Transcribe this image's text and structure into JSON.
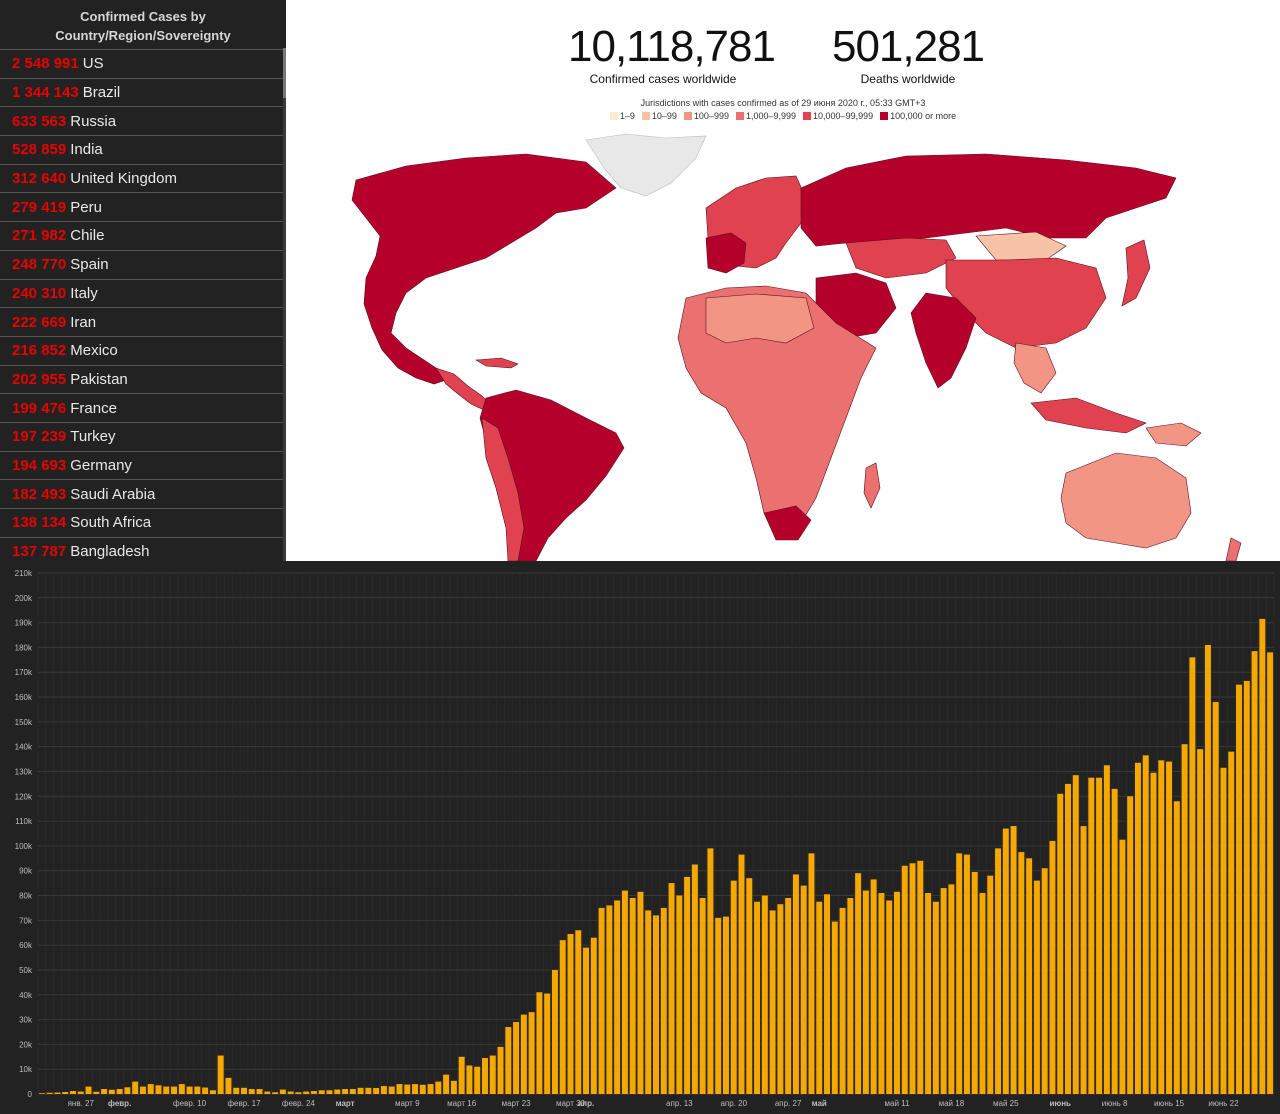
{
  "panel": {
    "title_line1": "Confirmed Cases by",
    "title_line2": "Country/Region/Sovereignty",
    "countries": [
      {
        "cases": "2 548 991",
        "name": "US"
      },
      {
        "cases": "1 344 143",
        "name": "Brazil"
      },
      {
        "cases": "633 563",
        "name": "Russia"
      },
      {
        "cases": "528 859",
        "name": "India"
      },
      {
        "cases": "312 640",
        "name": "United Kingdom"
      },
      {
        "cases": "279 419",
        "name": "Peru"
      },
      {
        "cases": "271 982",
        "name": "Chile"
      },
      {
        "cases": "248 770",
        "name": "Spain"
      },
      {
        "cases": "240 310",
        "name": "Italy"
      },
      {
        "cases": "222 669",
        "name": "Iran"
      },
      {
        "cases": "216 852",
        "name": "Mexico"
      },
      {
        "cases": "202 955",
        "name": "Pakistan"
      },
      {
        "cases": "199 476",
        "name": "France"
      },
      {
        "cases": "197 239",
        "name": "Turkey"
      },
      {
        "cases": "194 693",
        "name": "Germany"
      },
      {
        "cases": "182 493",
        "name": "Saudi Arabia"
      },
      {
        "cases": "138 134",
        "name": "South Africa"
      },
      {
        "cases": "137 787",
        "name": "Bangladesh"
      }
    ]
  },
  "map": {
    "confirmed_value": "10,118,781",
    "confirmed_label": "Confirmed cases worldwide",
    "deaths_value": "501,281",
    "deaths_label": "Deaths worldwide",
    "legend_title": "Jurisdictions with cases confirmed as of 29 июня 2020 г., 05:33 GMT+3",
    "legend": [
      {
        "label": "1–9",
        "color": "#fbeecb"
      },
      {
        "label": "10–99",
        "color": "#f7c3a6"
      },
      {
        "label": "100–999",
        "color": "#f29585"
      },
      {
        "label": "1,000–9,999",
        "color": "#eb7070"
      },
      {
        "label": "10,000–99,999",
        "color": "#e0434f"
      },
      {
        "label": "100,000 or more",
        "color": "#b5002b"
      }
    ]
  },
  "chart_data": {
    "type": "bar",
    "bar_color": "#f5a800",
    "background": "#222222",
    "grid": true,
    "ylim": [
      0,
      210000
    ],
    "yticks": [
      {
        "value": 0,
        "label": "0"
      },
      {
        "value": 10000,
        "label": "10k"
      },
      {
        "value": 20000,
        "label": "20k"
      },
      {
        "value": 30000,
        "label": "30k"
      },
      {
        "value": 40000,
        "label": "40k"
      },
      {
        "value": 50000,
        "label": "50k"
      },
      {
        "value": 60000,
        "label": "60k"
      },
      {
        "value": 70000,
        "label": "70k"
      },
      {
        "value": 80000,
        "label": "80k"
      },
      {
        "value": 90000,
        "label": "90k"
      },
      {
        "value": 100000,
        "label": "100k"
      },
      {
        "value": 110000,
        "label": "110k"
      },
      {
        "value": 120000,
        "label": "120k"
      },
      {
        "value": 130000,
        "label": "130k"
      },
      {
        "value": 140000,
        "label": "140k"
      },
      {
        "value": 150000,
        "label": "150k"
      },
      {
        "value": 160000,
        "label": "160k"
      },
      {
        "value": 170000,
        "label": "170k"
      },
      {
        "value": 180000,
        "label": "180k"
      },
      {
        "value": 190000,
        "label": "190k"
      },
      {
        "value": 200000,
        "label": "200k"
      },
      {
        "value": 210000,
        "label": "210k"
      }
    ],
    "xticks": [
      {
        "index": 5,
        "label": "янв. 27",
        "bold": false
      },
      {
        "index": 10,
        "label": "февр.",
        "bold": true
      },
      {
        "index": 19,
        "label": "февр. 10",
        "bold": false
      },
      {
        "index": 26,
        "label": "февр. 17",
        "bold": false
      },
      {
        "index": 33,
        "label": "февр. 24",
        "bold": false
      },
      {
        "index": 39,
        "label": "март",
        "bold": true
      },
      {
        "index": 47,
        "label": "март 9",
        "bold": false
      },
      {
        "index": 54,
        "label": "март 16",
        "bold": false
      },
      {
        "index": 61,
        "label": "март 23",
        "bold": false
      },
      {
        "index": 68,
        "label": "март 30",
        "bold": false
      },
      {
        "index": 70,
        "label": "апр.",
        "bold": true
      },
      {
        "index": 82,
        "label": "апр. 13",
        "bold": false
      },
      {
        "index": 89,
        "label": "апр. 20",
        "bold": false
      },
      {
        "index": 96,
        "label": "апр. 27",
        "bold": false
      },
      {
        "index": 100,
        "label": "май",
        "bold": true
      },
      {
        "index": 110,
        "label": "май 11",
        "bold": false
      },
      {
        "index": 117,
        "label": "май 18",
        "bold": false
      },
      {
        "index": 124,
        "label": "май 25",
        "bold": false
      },
      {
        "index": 131,
        "label": "июнь",
        "bold": true
      },
      {
        "index": 138,
        "label": "июнь 8",
        "bold": false
      },
      {
        "index": 145,
        "label": "июнь 15",
        "bold": false
      },
      {
        "index": 152,
        "label": "июнь 22",
        "bold": false
      }
    ],
    "values": [
      300,
      500,
      600,
      800,
      1200,
      1000,
      3000,
      900,
      2000,
      1700,
      2000,
      2700,
      5000,
      3000,
      4000,
      3500,
      3000,
      3000,
      4000,
      3000,
      3000,
      2600,
      1500,
      15500,
      6500,
      2500,
      2500,
      2000,
      2000,
      1000,
      700,
      1800,
      1000,
      700,
      1000,
      1200,
      1500,
      1500,
      1800,
      2000,
      2000,
      2500,
      2500,
      2400,
      3200,
      3000,
      4000,
      3800,
      4000,
      3700,
      4000,
      5000,
      7800,
      5300,
      15000,
      11500,
      11000,
      14500,
      15500,
      19000,
      27000,
      29000,
      32000,
      33000,
      41000,
      40500,
      50000,
      62000,
      64500,
      66000,
      59000,
      63000,
      75000,
      76000,
      78000,
      82000,
      79000,
      81500,
      74000,
      72000,
      75000,
      85000,
      80000,
      87500,
      92500,
      79000,
      99000,
      71000,
      71500,
      86000,
      96500,
      87000,
      77500,
      80000,
      74000,
      76500,
      79000,
      88500,
      84000,
      97000,
      77500,
      80500,
      69500,
      75000,
      79000,
      89000,
      82000,
      86500,
      81000,
      78000,
      81500,
      92000,
      93000,
      94000,
      81000,
      77500,
      83000,
      84500,
      97000,
      96500,
      89500,
      81000,
      88000,
      99000,
      107000,
      108000,
      97500,
      95000,
      86000,
      91000,
      102000,
      121000,
      125000,
      128500,
      108000,
      127500,
      127500,
      132500,
      123000,
      102500,
      120000,
      133500,
      136500,
      129500,
      134500,
      134000,
      118000,
      141000,
      176000,
      139000,
      181000,
      158000,
      131500,
      138000,
      165000,
      166500,
      178500,
      191500,
      178000
    ]
  }
}
